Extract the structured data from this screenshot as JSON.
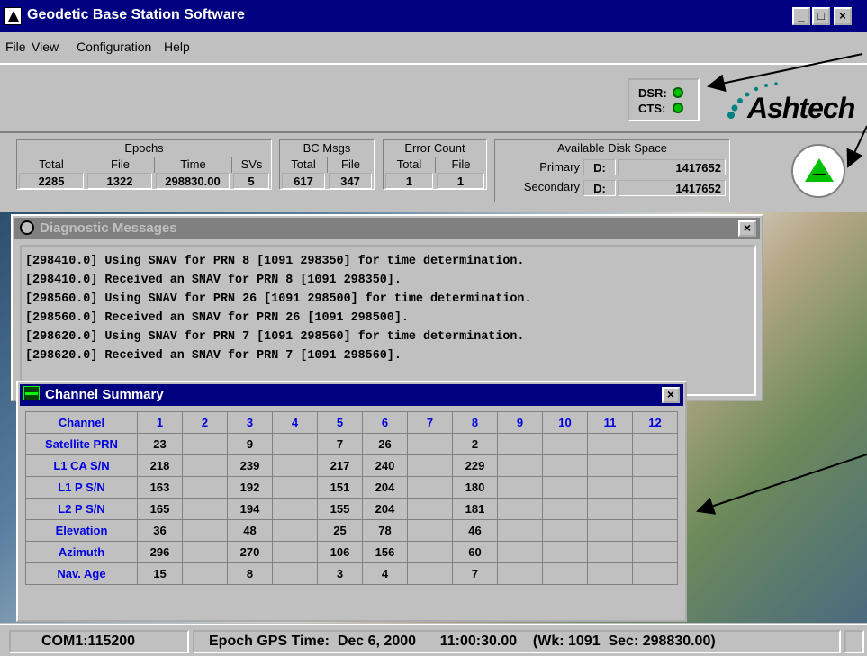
{
  "window": {
    "title": "Geodetic Base Station Software",
    "min": "_",
    "max": "□",
    "close": "×"
  },
  "menu": [
    "File",
    "View",
    "Configuration",
    "Help"
  ],
  "signals": {
    "dsr_label": "DSR:",
    "cts_label": "CTS:",
    "dsr_color": "#00c000",
    "cts_color": "#00c000"
  },
  "logo": {
    "text": "Ashtech"
  },
  "epochs": {
    "title": "Epochs",
    "cols": [
      "Total",
      "File",
      "Time",
      "SVs"
    ],
    "vals": [
      "2285",
      "1322",
      "298830.00",
      "5"
    ]
  },
  "bc_msgs": {
    "title": "BC Msgs",
    "cols": [
      "Total",
      "File"
    ],
    "vals": [
      "617",
      "347"
    ]
  },
  "error_count": {
    "title": "Error Count",
    "cols": [
      "Total",
      "File"
    ],
    "vals": [
      "1",
      "1"
    ]
  },
  "disk": {
    "title": "Available Disk Space",
    "primary": {
      "label": "Primary",
      "drive": "D:",
      "value": "1417652"
    },
    "secondary": {
      "label": "Secondary",
      "drive": "D:",
      "value": "1417652"
    }
  },
  "diagnostic": {
    "title": "Diagnostic Messages",
    "lines": [
      "[298410.0] Using SNAV for PRN 8 [1091 298350] for time determination.",
      "[298410.0] Received an SNAV for PRN 8 [1091 298350].",
      "[298560.0] Using SNAV for PRN 26 [1091 298500] for time determination.",
      "[298560.0] Received an SNAV for PRN 26 [1091 298500].",
      "[298620.0] Using SNAV for PRN 7 [1091 298560] for time determination.",
      "[298620.0] Received an SNAV for PRN 7 [1091 298560]."
    ]
  },
  "channel_summary": {
    "title": "Channel Summary",
    "header_label": "Channel",
    "channels": [
      "1",
      "2",
      "3",
      "4",
      "5",
      "6",
      "7",
      "8",
      "9",
      "10",
      "11",
      "12"
    ],
    "rows": [
      {
        "label": "Satellite PRN",
        "values": [
          "23",
          "",
          "9",
          "",
          "7",
          "26",
          "",
          "2",
          "",
          "",
          "",
          ""
        ]
      },
      {
        "label": "L1 CA S/N",
        "values": [
          "218",
          "",
          "239",
          "",
          "217",
          "240",
          "",
          "229",
          "",
          "",
          "",
          ""
        ]
      },
      {
        "label": "L1 P S/N",
        "values": [
          "163",
          "",
          "192",
          "",
          "151",
          "204",
          "",
          "180",
          "",
          "",
          "",
          ""
        ]
      },
      {
        "label": "L2 P S/N",
        "values": [
          "165",
          "",
          "194",
          "",
          "155",
          "204",
          "",
          "181",
          "",
          "",
          "",
          ""
        ]
      },
      {
        "label": "Elevation",
        "values": [
          "36",
          "",
          "48",
          "",
          "25",
          "78",
          "",
          "46",
          "",
          "",
          "",
          ""
        ]
      },
      {
        "label": "Azimuth",
        "values": [
          "296",
          "",
          "270",
          "",
          "106",
          "156",
          "",
          "60",
          "",
          "",
          "",
          ""
        ]
      },
      {
        "label": "Nav. Age",
        "values": [
          "15",
          "",
          "8",
          "",
          "3",
          "4",
          "",
          "7",
          "",
          "",
          "",
          ""
        ]
      }
    ]
  },
  "status": {
    "port": "COM1:115200",
    "epoch_label": "Epoch GPS Time:",
    "date": "Dec 6, 2000",
    "time": "11:00:30.00",
    "week_sec": "(Wk: 1091  Sec: 298830.00)"
  }
}
